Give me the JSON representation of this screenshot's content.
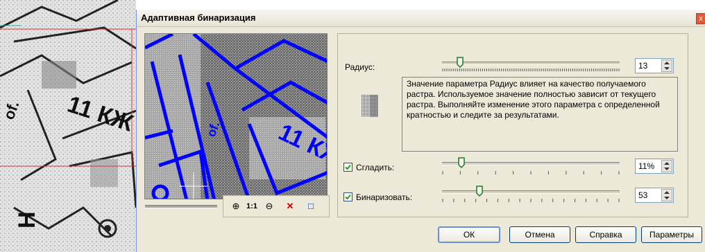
{
  "dialog": {
    "title": "Адаптивная бинаризация",
    "close": "x"
  },
  "settings": {
    "radius": {
      "label": "Радиус:",
      "value": "13",
      "fraction": 0.1
    },
    "hint": "Значение параметра Радиус влияет на качество получаемого растра. Используемое значение полностью зависит от текущего растра. Выполняйте изменение этого параметра с определенной кратностью и следите за результатами.",
    "smooth": {
      "label": "Сгладить:",
      "value": "11%",
      "checked": true,
      "fraction": 0.11
    },
    "binarize": {
      "label": "Бинаризовать:",
      "value": "53",
      "checked": true,
      "fraction": 0.21
    }
  },
  "toolbar": {
    "zoom_in": "⊕",
    "scale_1_1": "1:1",
    "zoom_out": "⊖",
    "delete": "✕",
    "fit": "□"
  },
  "buttons": {
    "ok": "ОК",
    "cancel": "Отмена",
    "help": "Справка",
    "params": "Параметры"
  },
  "preview_labels": {
    "sheet_text": "11 КЖ",
    "of_text": "of."
  },
  "map_labels": {
    "big_text": "11 КЖ",
    "of_text": "of."
  },
  "colors": {
    "accent_blue": "#0000ff",
    "titlebar": "#ece9d8"
  }
}
